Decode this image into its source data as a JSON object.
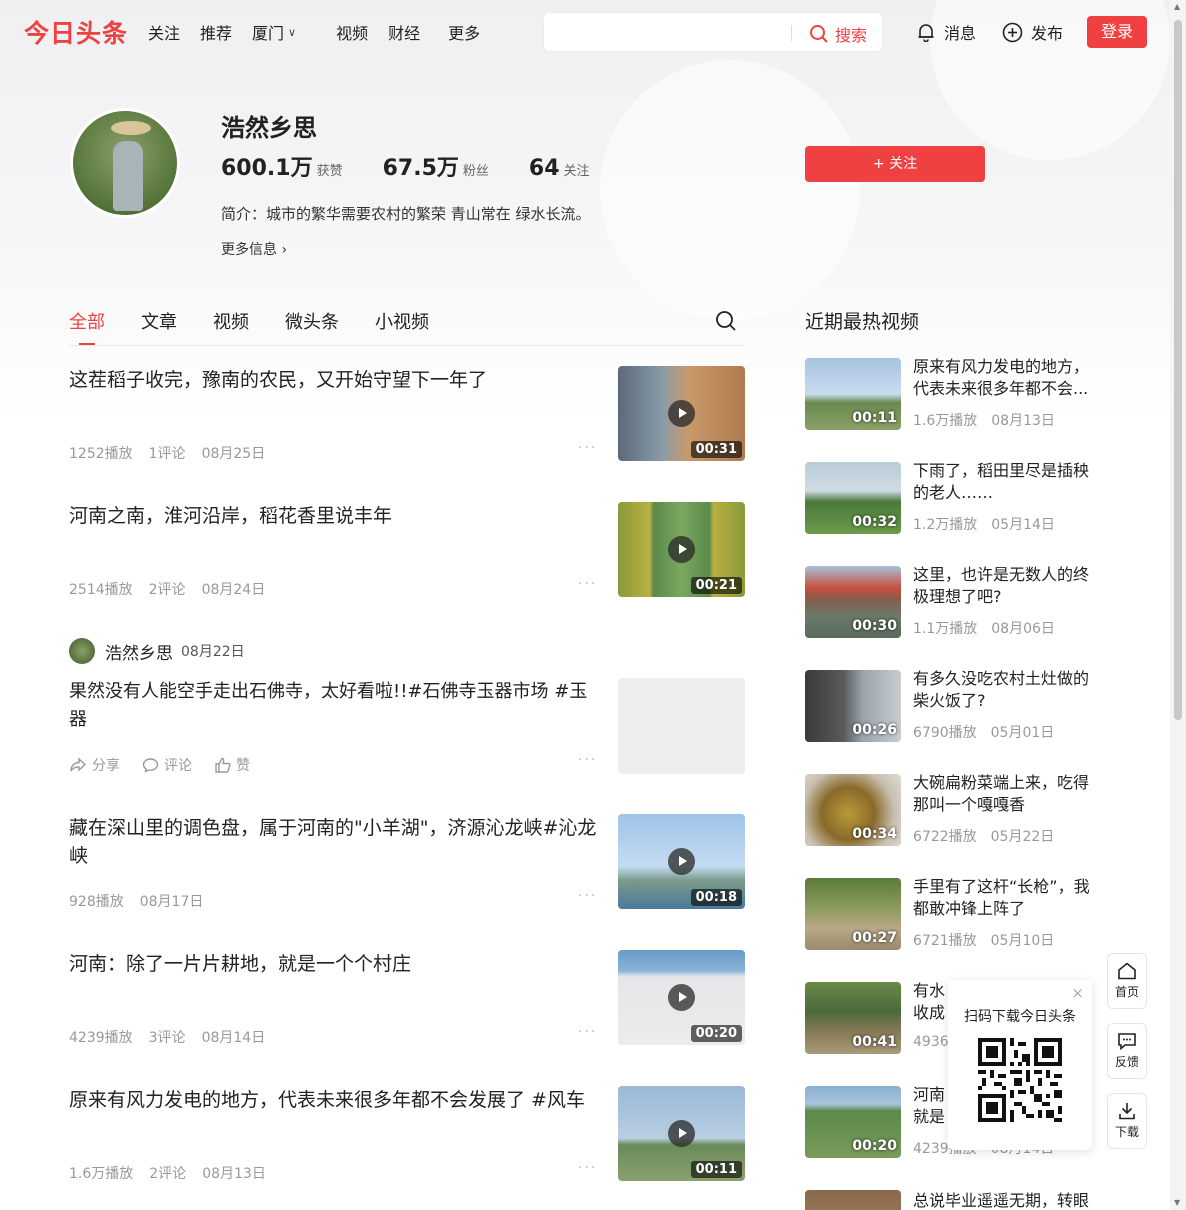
{
  "header": {
    "logo": "今日头条",
    "nav": [
      "关注",
      "推荐",
      "厦门",
      "视频",
      "财经",
      "更多"
    ],
    "search_button": "搜索",
    "messages": "消息",
    "publish": "发布",
    "login": "登录"
  },
  "profile": {
    "name": "浩然乡思",
    "stats": [
      {
        "value": "600.1万",
        "label": "获赞"
      },
      {
        "value": "67.5万",
        "label": "粉丝"
      },
      {
        "value": "64",
        "label": "关注"
      }
    ],
    "bio": "简介：城市的繁华需要农村的繁荣 青山常在 绿水长流。",
    "more_info": "更多信息 ›",
    "follow_button": "+ 关注"
  },
  "tabs": [
    "全部",
    "文章",
    "视频",
    "微头条",
    "小视频"
  ],
  "feed": [
    {
      "title": "这茬稻子收完，豫南的农民，又开始守望下一年了",
      "plays": "1252播放",
      "comments": "1评论",
      "date": "08月25日",
      "duration": "00:31"
    },
    {
      "title": "河南之南，淮河沿岸，稻花香里说丰年",
      "plays": "2514播放",
      "comments": "2评论",
      "date": "08月24日",
      "duration": "00:21"
    },
    {
      "author": "浩然乡思",
      "date": "08月22日",
      "text": "果然没有人能空手走出石佛寺，太好看啦!!#石佛寺玉器市场 #玉器",
      "share": "分享",
      "comment": "评论",
      "like": "赞"
    },
    {
      "title": "藏在深山里的调色盘，属于河南的\"小羊湖\"，济源沁龙峡#沁龙峡",
      "plays": "928播放",
      "date": "08月17日",
      "duration": "00:18"
    },
    {
      "title": "河南：除了一片片耕地，就是一个个村庄",
      "plays": "4239播放",
      "comments": "3评论",
      "date": "08月14日",
      "duration": "00:20"
    },
    {
      "title": "原来有风力发电的地方，代表未来很多年都不会发展了 #风车",
      "plays": "1.6万播放",
      "comments": "2评论",
      "date": "08月13日",
      "duration": "00:11"
    }
  ],
  "sidebar": {
    "title": "近期最热视频",
    "items": [
      {
        "title": "原来有风力发电的地方，代表未来很多年都不会...",
        "plays": "1.6万播放",
        "date": "08月13日",
        "duration": "00:11"
      },
      {
        "title": "下雨了，稻田里尽是插秧的老人……",
        "plays": "1.2万播放",
        "date": "05月14日",
        "duration": "00:32"
      },
      {
        "title": "这里，也许是无数人的终极理想了吧?",
        "plays": "1.1万播放",
        "date": "08月06日",
        "duration": "00:30"
      },
      {
        "title": "有多久没吃农村土灶做的柴火饭了?",
        "plays": "6790播放",
        "date": "05月01日",
        "duration": "00:26"
      },
      {
        "title": "大碗扁粉菜端上来，吃得那叫一个嘎嘎香",
        "plays": "6722播放",
        "date": "05月22日",
        "duration": "00:34"
      },
      {
        "title": "手里有了这杆“长枪”，我都敢冲锋上阵了",
        "plays": "6721播放",
        "date": "05月10日",
        "duration": "00:27"
      },
      {
        "title": "有水收成",
        "plays": "4936",
        "date": "",
        "duration": "00:41"
      },
      {
        "title": "河南就是",
        "plays": "4239播放",
        "date": "08月14日",
        "duration": "00:20"
      },
      {
        "title": "总说毕业遥遥无期，转眼",
        "plays": "",
        "date": "",
        "duration": ""
      }
    ]
  },
  "qr_popup": {
    "text": "扫码下载今日头条",
    "close": "×"
  },
  "floating": {
    "home": "首页",
    "feedback": "反馈",
    "download": "下载"
  },
  "colors": {
    "brand_red": "#f04142"
  }
}
